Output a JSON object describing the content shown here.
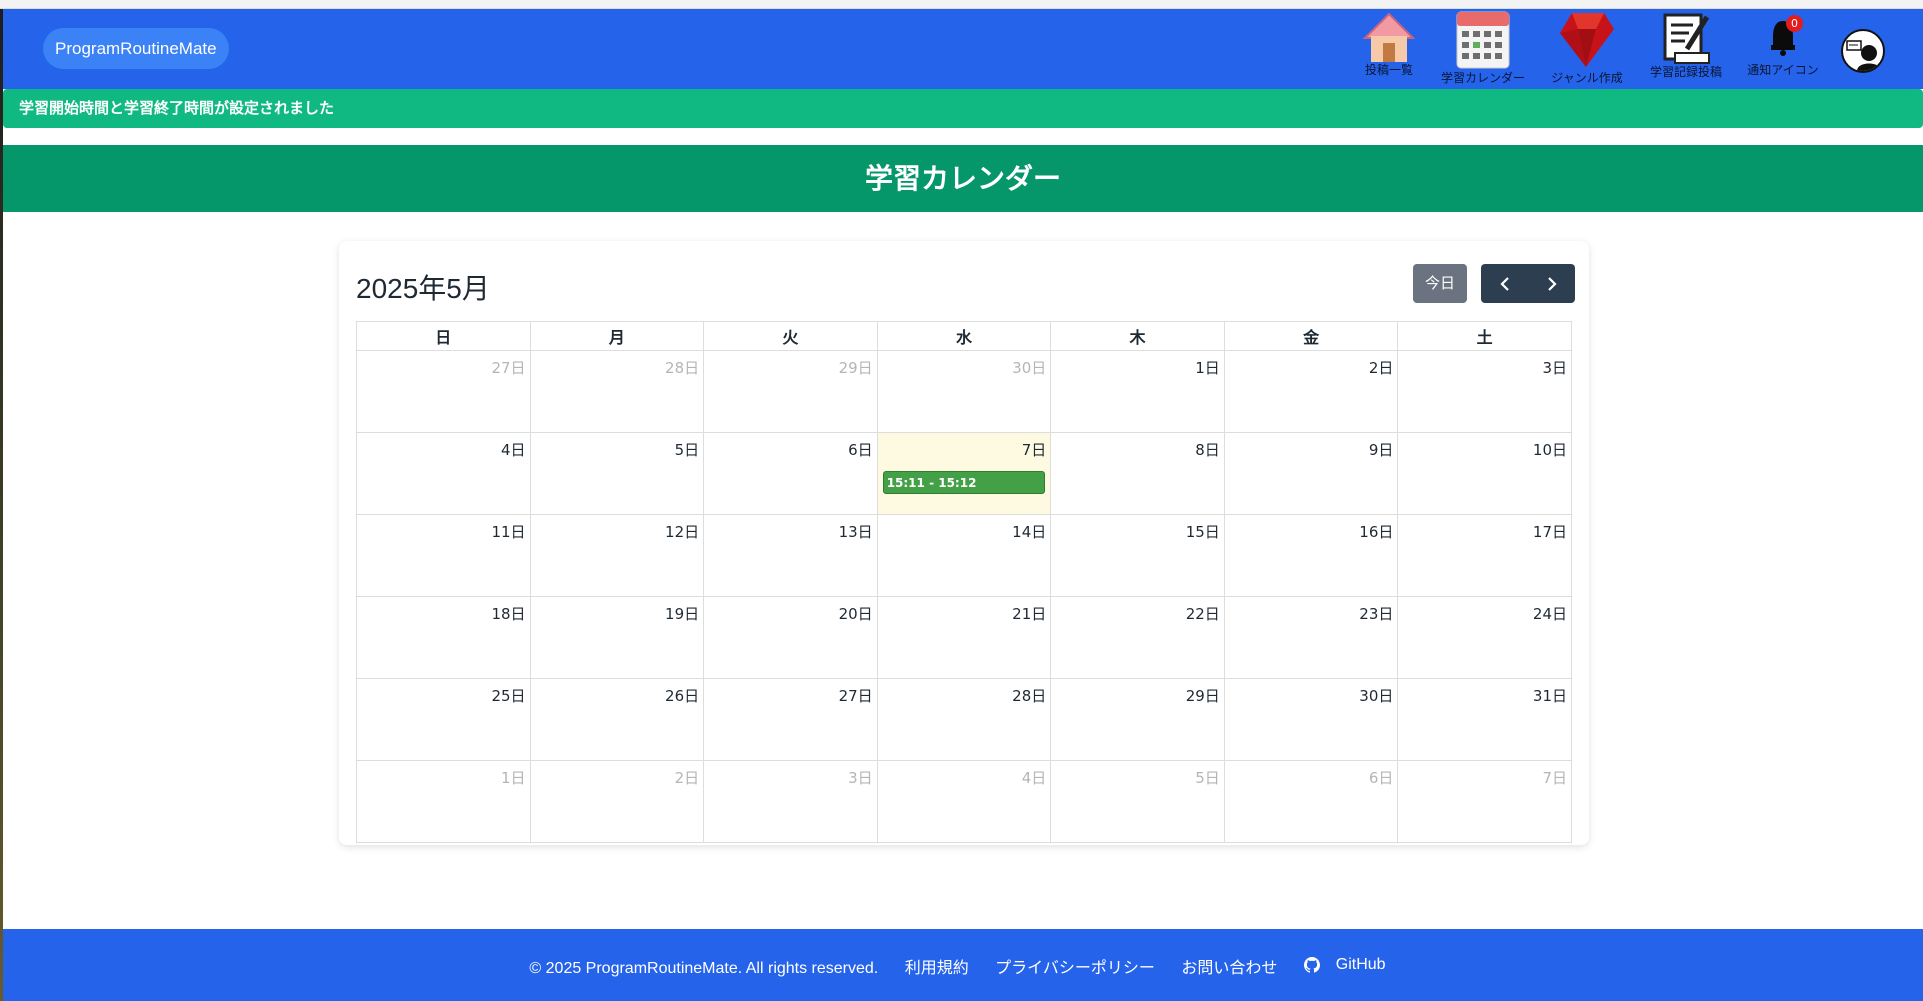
{
  "header": {
    "brand": "ProgramRoutineMate",
    "nav": [
      {
        "label": "投稿一覧",
        "icon": "house-icon"
      },
      {
        "label": "学習カレンダー",
        "icon": "calendar-icon"
      },
      {
        "label": "ジャンル作成",
        "icon": "ruby-gem-icon"
      },
      {
        "label": "学習記録投稿",
        "icon": "notepad-pen-icon"
      },
      {
        "label": "通知アイコン",
        "icon": "bell-icon",
        "badge": "0"
      }
    ],
    "avatar_icon": "user-avatar-icon"
  },
  "flash": {
    "message": "学習開始時間と学習終了時間が設定されました"
  },
  "page_title": "学習カレンダー",
  "calendar": {
    "title": "2025年5月",
    "today_label": "今日",
    "weekdays": [
      "日",
      "月",
      "火",
      "水",
      "木",
      "金",
      "土"
    ],
    "weeks": [
      [
        {
          "d": "27日",
          "other": true
        },
        {
          "d": "28日",
          "other": true
        },
        {
          "d": "29日",
          "other": true
        },
        {
          "d": "30日",
          "other": true
        },
        {
          "d": "1日"
        },
        {
          "d": "2日"
        },
        {
          "d": "3日"
        }
      ],
      [
        {
          "d": "4日"
        },
        {
          "d": "5日"
        },
        {
          "d": "6日"
        },
        {
          "d": "7日",
          "today": true,
          "event": "15:11 - 15:12"
        },
        {
          "d": "8日"
        },
        {
          "d": "9日"
        },
        {
          "d": "10日"
        }
      ],
      [
        {
          "d": "11日"
        },
        {
          "d": "12日"
        },
        {
          "d": "13日"
        },
        {
          "d": "14日"
        },
        {
          "d": "15日"
        },
        {
          "d": "16日"
        },
        {
          "d": "17日"
        }
      ],
      [
        {
          "d": "18日"
        },
        {
          "d": "19日"
        },
        {
          "d": "20日"
        },
        {
          "d": "21日"
        },
        {
          "d": "22日"
        },
        {
          "d": "23日"
        },
        {
          "d": "24日"
        }
      ],
      [
        {
          "d": "25日"
        },
        {
          "d": "26日"
        },
        {
          "d": "27日"
        },
        {
          "d": "28日"
        },
        {
          "d": "29日"
        },
        {
          "d": "30日"
        },
        {
          "d": "31日"
        }
      ],
      [
        {
          "d": "1日",
          "other": true
        },
        {
          "d": "2日",
          "other": true
        },
        {
          "d": "3日",
          "other": true
        },
        {
          "d": "4日",
          "other": true
        },
        {
          "d": "5日",
          "other": true
        },
        {
          "d": "6日",
          "other": true
        },
        {
          "d": "7日",
          "other": true
        }
      ]
    ]
  },
  "footer": {
    "copyright": "© 2025 ProgramRoutineMate. All rights reserved.",
    "links": [
      "利用規約",
      "プライバシーポリシー",
      "お問い合わせ"
    ],
    "github": "GitHub"
  },
  "colors": {
    "header": "#2563eb",
    "flash": "#10b981",
    "title_band": "#059669",
    "event": "#43a047",
    "today_bg": "#fef9e1"
  }
}
